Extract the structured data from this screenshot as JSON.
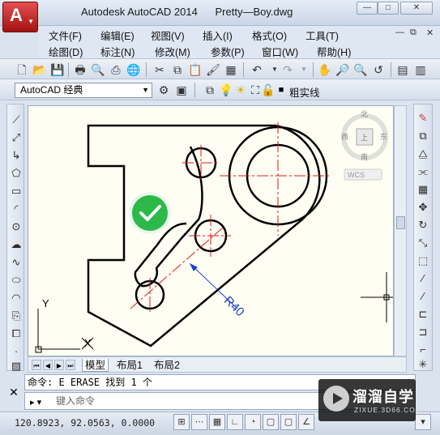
{
  "window": {
    "title": "Autodesk AutoCAD 2014",
    "filename": "Pretty—Boy.dwg",
    "buttons": {
      "minimize": "—",
      "maximize": "□",
      "close": "✕"
    }
  },
  "menu": {
    "row1": [
      "文件(F)",
      "编辑(E)",
      "视图(V)",
      "插入(I)",
      "格式(O)",
      "工具(T)"
    ],
    "row2": [
      "绘图(D)",
      "标注(N)",
      "修改(M)",
      "参数(P)",
      "窗口(W)",
      "帮助(H)"
    ]
  },
  "toolbar": {
    "workspace": "AutoCAD 经典",
    "layer": "粗实线"
  },
  "viewcube": {
    "north": "北",
    "south": "南",
    "east": "东",
    "west": "西",
    "top": "上",
    "wcs": "WCS"
  },
  "drawing": {
    "dimension": "R40",
    "ucs_x": "X",
    "ucs_y": "Y"
  },
  "tabs": [
    "模型",
    "布局1",
    "布局2"
  ],
  "command": {
    "history": "命令: E ERASE 找到 1 个",
    "placeholder": "键入命令"
  },
  "status": {
    "coords": "120.8923, 92.0563, 0.0000"
  },
  "watermark": {
    "main": "溜溜自学",
    "sub": "ZIXUE.3D66.COM"
  },
  "colors": {
    "center_line": "#e0191b",
    "dimension": "#1c3fd1",
    "check": "#2db84a",
    "background": "#fffef2"
  }
}
